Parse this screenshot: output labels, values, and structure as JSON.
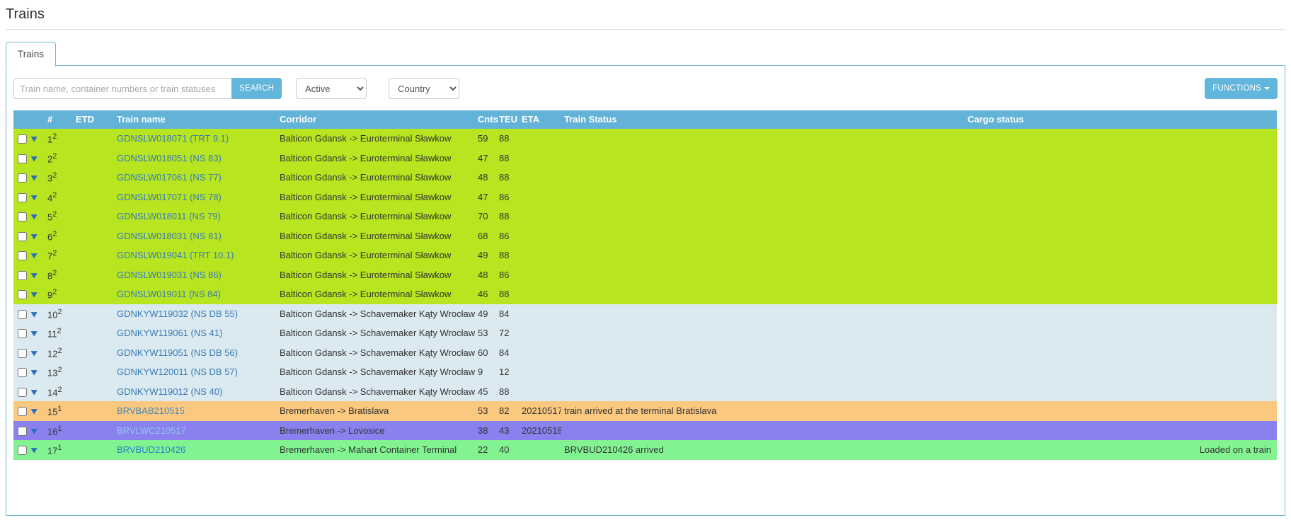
{
  "page": {
    "title": "Trains"
  },
  "tabs": [
    {
      "label": "Trains"
    }
  ],
  "toolbar": {
    "search_placeholder": "Train name, container numbers or train statuses",
    "search_value": "",
    "search_button": "SEARCH",
    "status_filter": {
      "selected": "Active",
      "options": [
        "Active"
      ]
    },
    "country_filter": {
      "selected": "Country",
      "options": [
        "Country"
      ]
    },
    "functions_button": "FUNCTIONS"
  },
  "table": {
    "headers": {
      "check": "",
      "expand": "",
      "number": "#",
      "etd": "ETD",
      "train_name": "Train name",
      "corridor": "Corridor",
      "cnts": "Cnts",
      "teu": "TEU",
      "eta": "ETA",
      "train_status": "Train Status",
      "cargo_status": "Cargo status"
    },
    "rows": [
      {
        "num": "1",
        "sup": "2",
        "etd": "",
        "name": "GDNSLW018071 (TRT 9.1)",
        "corridor": "Balticon Gdansk -> Euroterminal Sławkow",
        "cnts": "59",
        "teu": "88",
        "eta": "",
        "train_status": "",
        "cargo_status": "",
        "color": "green"
      },
      {
        "num": "2",
        "sup": "2",
        "etd": "",
        "name": "GDNSLW018051 (NS 83)",
        "corridor": "Balticon Gdansk -> Euroterminal Sławkow",
        "cnts": "47",
        "teu": "88",
        "eta": "",
        "train_status": "",
        "cargo_status": "",
        "color": "green"
      },
      {
        "num": "3",
        "sup": "2",
        "etd": "",
        "name": "GDNSLW017061 (NS 77)",
        "corridor": "Balticon Gdansk -> Euroterminal Sławkow",
        "cnts": "48",
        "teu": "88",
        "eta": "",
        "train_status": "",
        "cargo_status": "",
        "color": "green"
      },
      {
        "num": "4",
        "sup": "2",
        "etd": "",
        "name": "GDNSLW017071 (NS 78)",
        "corridor": "Balticon Gdansk -> Euroterminal Sławkow",
        "cnts": "47",
        "teu": "86",
        "eta": "",
        "train_status": "",
        "cargo_status": "",
        "color": "green"
      },
      {
        "num": "5",
        "sup": "2",
        "etd": "",
        "name": "GDNSLW018011 (NS 79)",
        "corridor": "Balticon Gdansk -> Euroterminal Sławkow",
        "cnts": "70",
        "teu": "88",
        "eta": "",
        "train_status": "",
        "cargo_status": "",
        "color": "green"
      },
      {
        "num": "6",
        "sup": "2",
        "etd": "",
        "name": "GDNSLW018031 (NS 81)",
        "corridor": "Balticon Gdansk -> Euroterminal Sławkow",
        "cnts": "68",
        "teu": "86",
        "eta": "",
        "train_status": "",
        "cargo_status": "",
        "color": "green"
      },
      {
        "num": "7",
        "sup": "2",
        "etd": "",
        "name": "GDNSLW019041 (TRT 10.1)",
        "corridor": "Balticon Gdansk -> Euroterminal Sławkow",
        "cnts": "49",
        "teu": "88",
        "eta": "",
        "train_status": "",
        "cargo_status": "",
        "color": "green"
      },
      {
        "num": "8",
        "sup": "2",
        "etd": "",
        "name": "GDNSLW019031 (NS 86)",
        "corridor": "Balticon Gdansk -> Euroterminal Sławkow",
        "cnts": "48",
        "teu": "86",
        "eta": "",
        "train_status": "",
        "cargo_status": "",
        "color": "green"
      },
      {
        "num": "9",
        "sup": "2",
        "etd": "",
        "name": "GDNSLW019011 (NS 84)",
        "corridor": "Balticon Gdansk -> Euroterminal Sławkow",
        "cnts": "46",
        "teu": "88",
        "eta": "",
        "train_status": "",
        "cargo_status": "",
        "color": "green"
      },
      {
        "num": "10",
        "sup": "2",
        "etd": "",
        "name": "GDNKYW119032 (NS DB 55)",
        "corridor": "Balticon Gdansk -> Schavemaker Kąty Wrocławskie",
        "cnts": "49",
        "teu": "84",
        "eta": "",
        "train_status": "",
        "cargo_status": "",
        "color": "blue"
      },
      {
        "num": "11",
        "sup": "2",
        "etd": "",
        "name": "GDNKYW119061 (NS 41)",
        "corridor": "Balticon Gdansk -> Schavemaker Kąty Wrocławskie",
        "cnts": "53",
        "teu": "72",
        "eta": "",
        "train_status": "",
        "cargo_status": "",
        "color": "blue"
      },
      {
        "num": "12",
        "sup": "2",
        "etd": "",
        "name": "GDNKYW119051 (NS DB 56)",
        "corridor": "Balticon Gdansk -> Schavemaker Kąty Wrocławskie",
        "cnts": "60",
        "teu": "84",
        "eta": "",
        "train_status": "",
        "cargo_status": "",
        "color": "blue"
      },
      {
        "num": "13",
        "sup": "2",
        "etd": "",
        "name": "GDNKYW120011 (NS DB 57)",
        "corridor": "Balticon Gdansk -> Schavemaker Kąty Wrocławskie",
        "cnts": "9",
        "teu": "12",
        "eta": "",
        "train_status": "",
        "cargo_status": "",
        "color": "blue"
      },
      {
        "num": "14",
        "sup": "2",
        "etd": "",
        "name": "GDNKYW119012 (NS 40)",
        "corridor": "Balticon Gdansk -> Schavemaker Kąty Wrocławskie",
        "cnts": "45",
        "teu": "88",
        "eta": "",
        "train_status": "",
        "cargo_status": "",
        "color": "blue"
      },
      {
        "num": "15",
        "sup": "1",
        "etd": "",
        "name": "BRVBAB210515",
        "corridor": "Bremerhaven -> Bratislava",
        "cnts": "53",
        "teu": "82",
        "eta": "20210517",
        "train_status": "train arrived at the terminal Bratislava",
        "cargo_status": "",
        "color": "orange"
      },
      {
        "num": "16",
        "sup": "1",
        "etd": "",
        "name": "BRVLWC210517",
        "corridor": "Bremerhaven -> Lovosice",
        "cnts": "38",
        "teu": "43",
        "eta": "20210518",
        "train_status": "",
        "cargo_status": "",
        "color": "purple"
      },
      {
        "num": "17",
        "sup": "1",
        "etd": "",
        "name": "BRVBUD210426",
        "corridor": "Bremerhaven -> Mahart Container Terminal",
        "cnts": "22",
        "teu": "40",
        "eta": "",
        "train_status": "BRVBUD210426 arrived",
        "cargo_status": "Loaded on a train",
        "color": "lgreen"
      }
    ]
  },
  "icons": {
    "chevron_down": "⌄",
    "caret_down": "caret-down-icon"
  },
  "colors": {
    "accent": "#62b5db",
    "header_bg": "#63b3d8",
    "row_green": "#b7e520",
    "row_blue": "#dbeaf0",
    "row_orange": "#fac87e",
    "row_purple": "#8a80ee",
    "row_light_green": "#83f392",
    "link": "#3b7ab5"
  }
}
